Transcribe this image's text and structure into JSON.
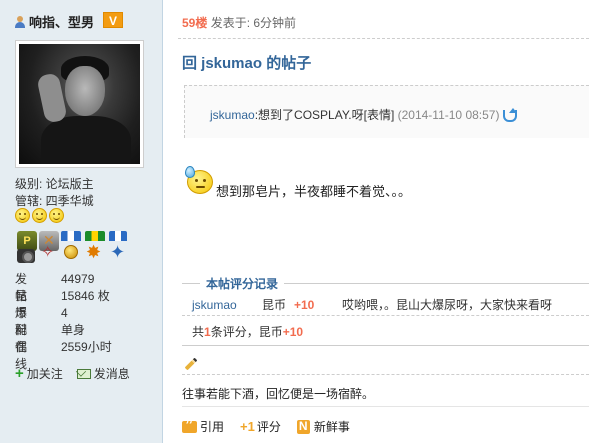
{
  "user": {
    "name": "响指、型男",
    "badge": "V",
    "level_label": "级别: ",
    "level": "论坛版主",
    "manage_label": "管辖: ",
    "manage": "四季华城",
    "stats": [
      {
        "label": "发帖",
        "value": "44979"
      },
      {
        "label": "昆币",
        "value": "15846 枚"
      },
      {
        "label": "爆料",
        "value": "4"
      },
      {
        "label": "配偶",
        "value": "单身"
      },
      {
        "label": "在线",
        "value": "2559小时"
      }
    ],
    "follow_label": "加关注",
    "message_label": "发消息"
  },
  "post": {
    "floor": "59楼",
    "posted": "发表于: 6分钟前",
    "reply_title": "回 jskumao 的帖子",
    "quote": {
      "author": "jskumao",
      "text": ":想到了COSPLAY.呀[表情]",
      "time": " (2014-11-10 08:57)"
    },
    "body": "想到那皂片，半夜都睡不着觉、。。"
  },
  "rating": {
    "title": "本帖评分记录",
    "rows": [
      {
        "user": "jskumao",
        "kind": "昆币",
        "value": "+10",
        "reason": "哎哟喂，。昆山大爆尿呀，大家快来看呀"
      }
    ],
    "summary_prefix": "共",
    "summary_count": "1",
    "summary_mid": "条评分，昆币",
    "summary_value": "+10"
  },
  "signature": "往事若能下酒，回忆便是一场宿醉。",
  "actions": {
    "quote": "引用",
    "rate_plus": "+1",
    "rate": "评分",
    "news": "新鲜事"
  }
}
